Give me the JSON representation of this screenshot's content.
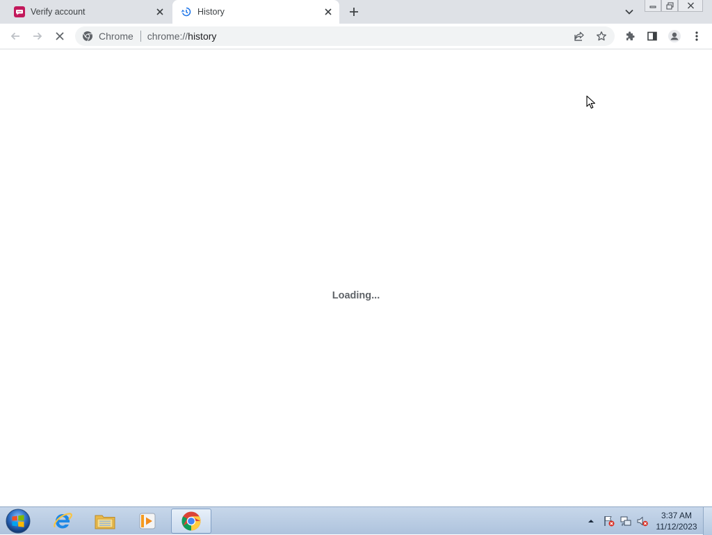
{
  "browser": {
    "tabs": [
      {
        "title": "Verify account",
        "icon": "chat-bubble-icon",
        "active": false
      },
      {
        "title": "History",
        "icon": "history-icon",
        "active": true
      }
    ],
    "address_bar": {
      "site_label": "Chrome",
      "url_scheme": "chrome://",
      "url_host": "history"
    },
    "page": {
      "loading_text": "Loading..."
    }
  },
  "taskbar": {
    "apps": [
      "internet-explorer-icon",
      "file-explorer-icon",
      "media-player-icon",
      "chrome-icon"
    ],
    "active_app": "chrome-icon",
    "clock": {
      "time": "3:37 AM",
      "date": "11/12/2023"
    }
  },
  "colors": {
    "tabstrip_bg": "#dee1e6",
    "omnibox_bg": "#f1f3f4",
    "loading_text": "#5f6368",
    "taskbar_bg": "#b9cce3"
  }
}
